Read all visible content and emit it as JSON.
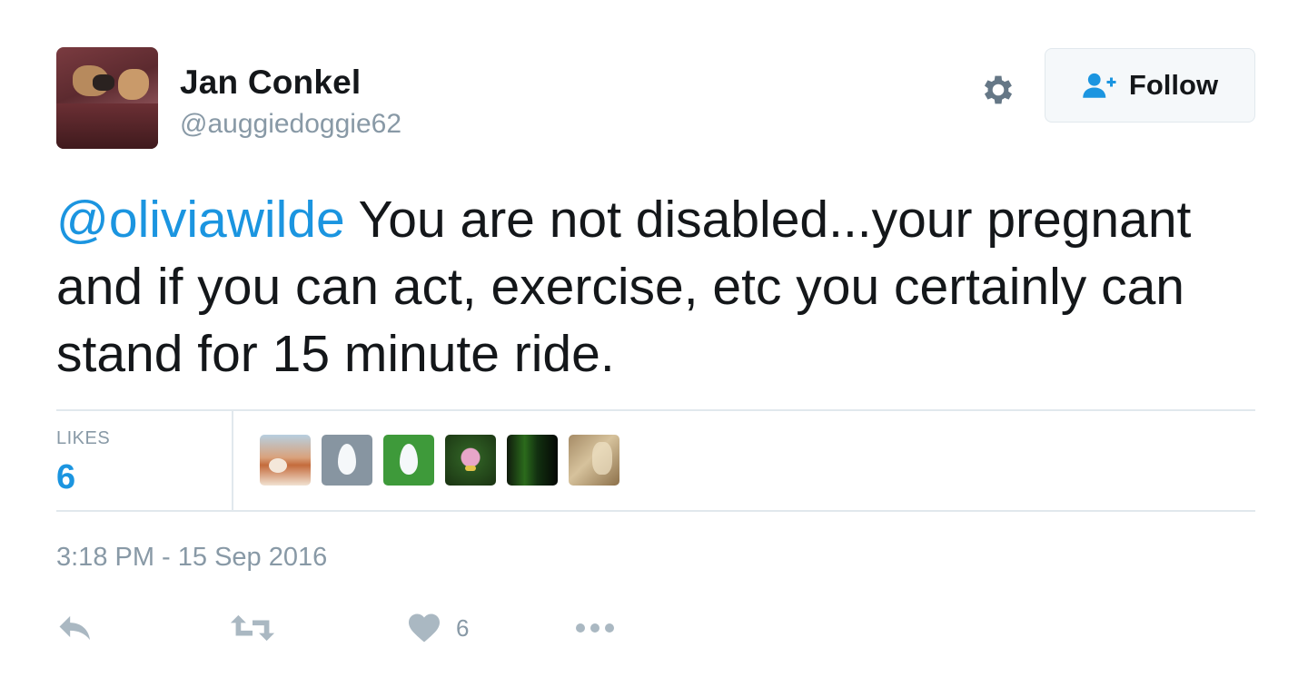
{
  "user": {
    "display_name": "Jan Conkel",
    "handle": "@auggiedoggie62"
  },
  "header": {
    "follow_label": "Follow",
    "settings_icon": "gear-icon",
    "follow_icon": "add-user-icon"
  },
  "tweet": {
    "mention": "@oliviawilde",
    "text": " You are not disabled...your pregnant and if you can act, exercise, etc you certainly can stand for 15 minute ride.",
    "timestamp": "3:18 PM - 15 Sep 2016"
  },
  "stats": {
    "likes_label": "LIKES",
    "likes_count": "6",
    "likers": [
      "liker-avatar-1",
      "liker-avatar-2",
      "liker-avatar-3",
      "liker-avatar-4",
      "liker-avatar-5",
      "liker-avatar-6"
    ]
  },
  "actions": {
    "reply_icon": "reply-icon",
    "retweet_icon": "retweet-icon",
    "like_icon": "heart-icon",
    "like_count": "6",
    "more_icon": "more-icon"
  },
  "colors": {
    "link": "#1b95e0",
    "muted": "#8899a6",
    "text": "#14171a",
    "divider": "#e1e8ed"
  }
}
